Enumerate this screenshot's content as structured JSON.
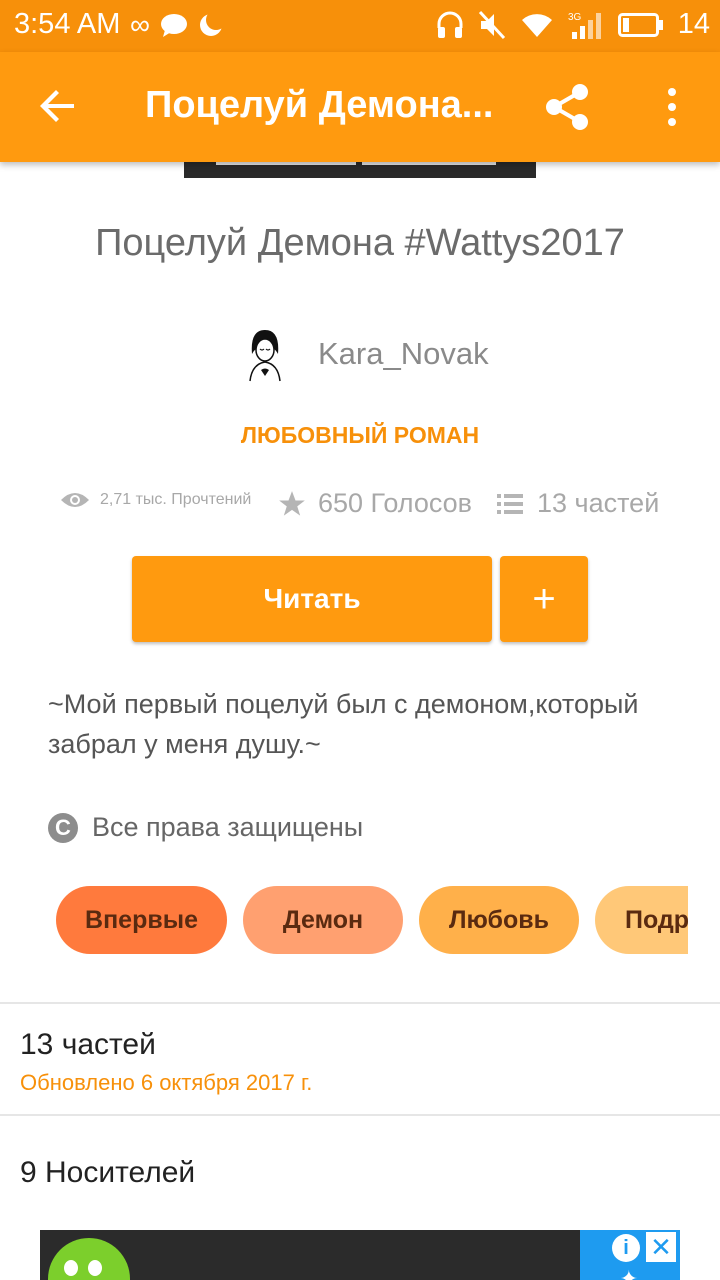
{
  "status_bar": {
    "time": "3:54 AM",
    "battery": "14",
    "network": "3G"
  },
  "toolbar": {
    "title": "Поцелуй Демона...",
    "back_icon": "arrow-back-icon",
    "share_icon": "share-icon",
    "more_icon": "more-vert-icon"
  },
  "story": {
    "title": "Поцелуй Демона #Wattys2017",
    "author": "Kara_Novak",
    "genre": "ЛЮБОВНЫЙ РОМАН",
    "stats": {
      "reads": "2,71 тыс. Прочтений",
      "votes": "650 Голосов",
      "parts": "13 частей"
    },
    "read_button": "Читать",
    "add_button": "+",
    "description": "~Мой первый поцелуй был с демоном,который забрал у меня душу.~",
    "copyright": "Все права защищены",
    "tags": [
      {
        "label": "Впервые",
        "color": "#ff7a3d"
      },
      {
        "label": "Демон",
        "color": "#ffa070"
      },
      {
        "label": "Любовь",
        "color": "#ffb04a"
      },
      {
        "label": "Подр",
        "color": "#ffc878"
      }
    ]
  },
  "parts_section": {
    "title": "13 частей",
    "updated": "Обновлено 6 октября 2017 г."
  },
  "carriers": {
    "title": "9 Носителей"
  },
  "colors": {
    "accent": "#ff9a0f",
    "status_bar": "#f7900a"
  }
}
